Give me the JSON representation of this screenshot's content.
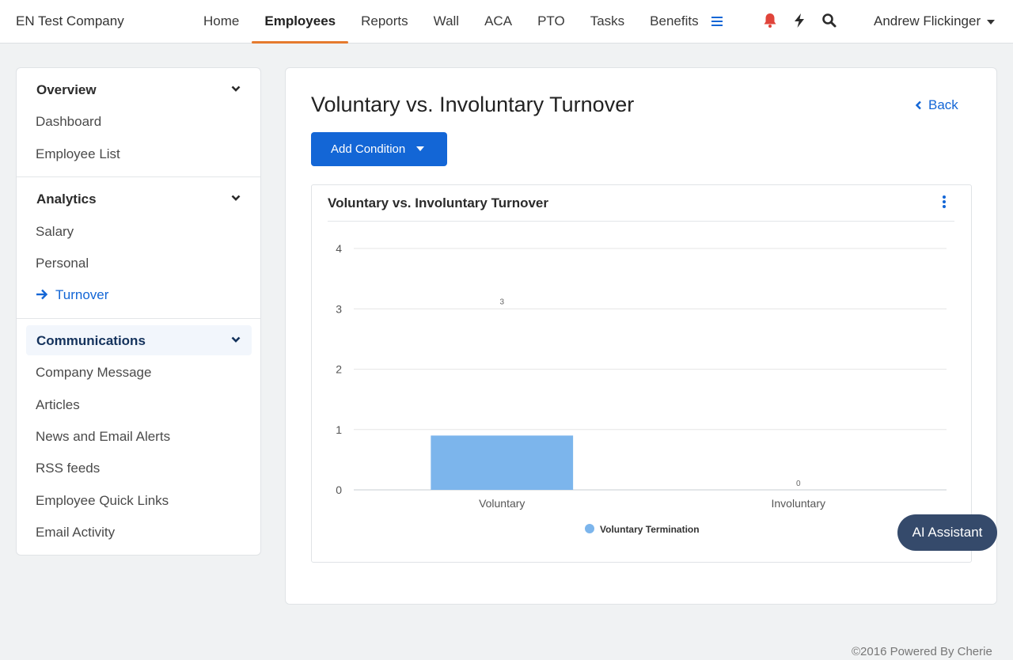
{
  "app": {
    "company": "EN Test Company"
  },
  "nav": {
    "items": [
      "Home",
      "Employees",
      "Reports",
      "Wall",
      "ACA",
      "PTO",
      "Tasks",
      "Benefits"
    ],
    "active": "Employees",
    "user": "Andrew Flickinger",
    "icons": [
      "menu-icon",
      "bell-icon",
      "bolt-icon",
      "search-icon"
    ]
  },
  "sidebar": {
    "overview": {
      "title": "Overview",
      "links": [
        "Dashboard",
        "Employee List"
      ]
    },
    "analytics": {
      "title": "Analytics",
      "links": [
        "Salary",
        "Personal",
        "Turnover"
      ],
      "current": "Turnover"
    },
    "communications": {
      "title": "Communications",
      "links": [
        "Company Message",
        "Articles",
        "News and Email Alerts",
        "RSS feeds",
        "Employee Quick Links",
        "Email Activity"
      ]
    }
  },
  "main": {
    "title": "Voluntary vs. Involuntary Turnover",
    "back_label": "Back",
    "add_condition_label": "Add Condition",
    "chart_card_title": "Voluntary vs. Involuntary Turnover"
  },
  "chart_data": {
    "type": "bar",
    "title": "Voluntary vs. Involuntary Turnover",
    "categories": [
      "Voluntary",
      "Involuntary"
    ],
    "series": [
      {
        "name": "Voluntary Termination",
        "values": [
          0.9,
          0
        ],
        "data_labels": [
          "3",
          "0"
        ],
        "color": "#7cb5ec"
      }
    ],
    "ylim": [
      0,
      4
    ],
    "yticks": [
      0,
      1,
      2,
      3,
      4
    ],
    "grid": true,
    "legend": "bottom-center"
  },
  "ai_assistant_label": "AI Assistant",
  "footer": "©2016 Powered By Cherie"
}
